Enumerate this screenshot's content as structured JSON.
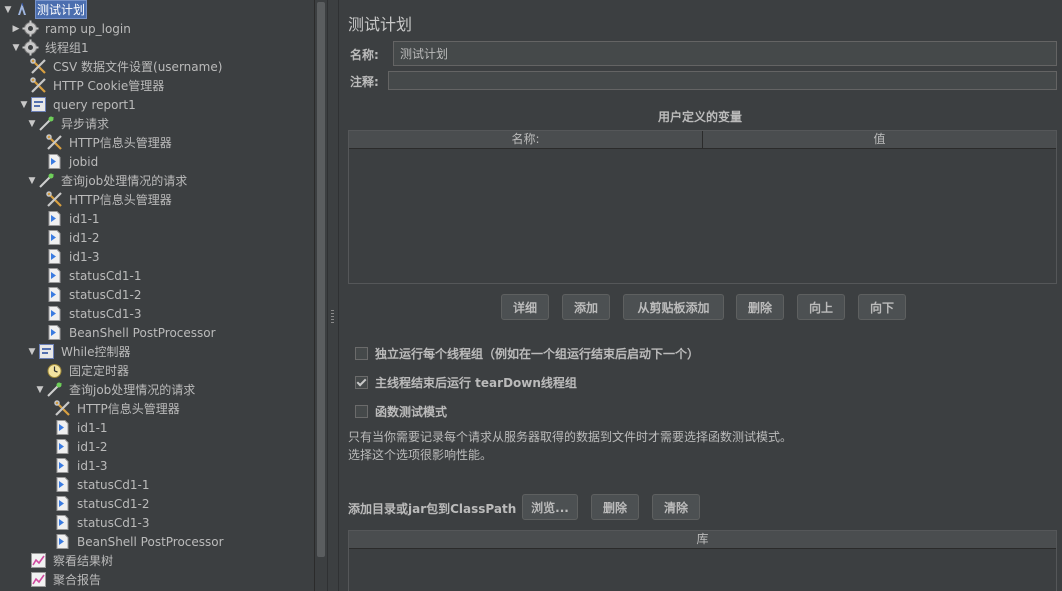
{
  "tree": [
    {
      "label": "测试计划",
      "icon": "test-plan-icon",
      "depth": 0,
      "arrow": "▼",
      "selected": true
    },
    {
      "label": "ramp up_login",
      "icon": "gear-icon",
      "depth": 1,
      "arrow": "▶"
    },
    {
      "label": "线程组1",
      "icon": "gear-icon",
      "depth": 1,
      "arrow": "▼"
    },
    {
      "label": "CSV 数据文件设置(username)",
      "icon": "wrench-icon",
      "depth": 2,
      "arrow": ""
    },
    {
      "label": "HTTP Cookie管理器",
      "icon": "wrench-icon",
      "depth": 2,
      "arrow": ""
    },
    {
      "label": "query report1",
      "icon": "controller-icon",
      "depth": 2,
      "arrow": "▼"
    },
    {
      "label": "异步请求",
      "icon": "pipette-icon",
      "depth": 3,
      "arrow": "▼"
    },
    {
      "label": "HTTP信息头管理器",
      "icon": "wrench-icon",
      "depth": 4,
      "arrow": ""
    },
    {
      "label": "jobid",
      "icon": "extractor-icon",
      "depth": 4,
      "arrow": ""
    },
    {
      "label": "查询job处理情况的请求",
      "icon": "pipette-icon",
      "depth": 3,
      "arrow": "▼"
    },
    {
      "label": "HTTP信息头管理器",
      "icon": "wrench-icon",
      "depth": 4,
      "arrow": ""
    },
    {
      "label": "id1-1",
      "icon": "extractor-icon",
      "depth": 4,
      "arrow": ""
    },
    {
      "label": "id1-2",
      "icon": "extractor-icon",
      "depth": 4,
      "arrow": ""
    },
    {
      "label": "id1-3",
      "icon": "extractor-icon",
      "depth": 4,
      "arrow": ""
    },
    {
      "label": "statusCd1-1",
      "icon": "extractor-icon",
      "depth": 4,
      "arrow": ""
    },
    {
      "label": "statusCd1-2",
      "icon": "extractor-icon",
      "depth": 4,
      "arrow": ""
    },
    {
      "label": "statusCd1-3",
      "icon": "extractor-icon",
      "depth": 4,
      "arrow": ""
    },
    {
      "label": "BeanShell PostProcessor",
      "icon": "extractor-icon",
      "depth": 4,
      "arrow": ""
    },
    {
      "label": "While控制器",
      "icon": "controller-icon",
      "depth": 3,
      "arrow": "▼"
    },
    {
      "label": "固定定时器",
      "icon": "timer-icon",
      "depth": 4,
      "arrow": ""
    },
    {
      "label": "查询job处理情况的请求",
      "icon": "pipette-icon",
      "depth": 4,
      "arrow": "▼"
    },
    {
      "label": "HTTP信息头管理器",
      "icon": "wrench-icon",
      "depth": 5,
      "arrow": ""
    },
    {
      "label": "id1-1",
      "icon": "extractor-icon",
      "depth": 5,
      "arrow": ""
    },
    {
      "label": "id1-2",
      "icon": "extractor-icon",
      "depth": 5,
      "arrow": ""
    },
    {
      "label": "id1-3",
      "icon": "extractor-icon",
      "depth": 5,
      "arrow": ""
    },
    {
      "label": "statusCd1-1",
      "icon": "extractor-icon",
      "depth": 5,
      "arrow": ""
    },
    {
      "label": "statusCd1-2",
      "icon": "extractor-icon",
      "depth": 5,
      "arrow": ""
    },
    {
      "label": "statusCd1-3",
      "icon": "extractor-icon",
      "depth": 5,
      "arrow": ""
    },
    {
      "label": "BeanShell PostProcessor",
      "icon": "extractor-icon",
      "depth": 5,
      "arrow": ""
    },
    {
      "label": "察看结果树",
      "icon": "graph-icon",
      "depth": 2,
      "arrow": ""
    },
    {
      "label": "聚合报告",
      "icon": "graph-icon",
      "depth": 2,
      "arrow": ""
    }
  ],
  "panel": {
    "title": "测试计划",
    "name_label": "名称:",
    "name_value": "测试计划",
    "comment_label": "注释:",
    "comment_value": "",
    "vars_title": "用户定义的变量",
    "vars_columns": [
      "名称:",
      "值"
    ],
    "buttons": {
      "detail": "详细",
      "add": "添加",
      "paste": "从剪贴板添加",
      "delete": "删除",
      "up": "向上",
      "down": "向下"
    },
    "options": [
      {
        "label": "独立运行每个线程组（例如在一个组运行结束后启动下一个）",
        "checked": false
      },
      {
        "label": "主线程结束后运行 tearDown线程组",
        "checked": true
      },
      {
        "label": "函数测试模式",
        "checked": false
      }
    ],
    "note_line1": "只有当你需要记录每个请求从服务器取得的数据到文件时才需要选择函数测试模式。",
    "note_line2": "选择这个选项很影响性能。",
    "classpath_label": "添加目录或jar包到ClassPath",
    "classpath_buttons": {
      "browse": "浏览...",
      "delete": "删除",
      "clear": "清除"
    },
    "lib_column": "库"
  },
  "colors": {
    "bg": "#3c3f41",
    "selection": "#4b6eaf",
    "field": "#45494a"
  }
}
